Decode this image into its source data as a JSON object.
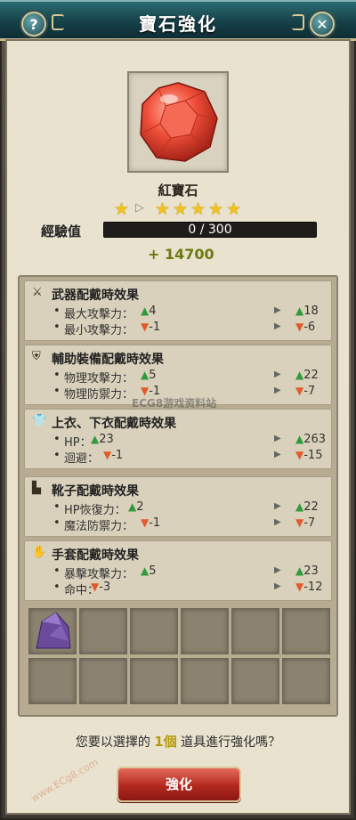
{
  "window": {
    "title": "寶石強化",
    "help_label": "?",
    "close_label": "✕"
  },
  "gem": {
    "name": "紅寶石"
  },
  "stars": {
    "current": 1,
    "next": 5,
    "arrow": "▷"
  },
  "exp": {
    "label": "經驗值",
    "text": "0 / 300",
    "progress": 0,
    "gain": "+ 14700"
  },
  "sections": [
    {
      "icon": "sword-icon",
      "glyph": "⚔",
      "title": "武器配戴時效果",
      "rows": [
        {
          "label": "最大攻擊力：",
          "dir": "up",
          "cur": "4",
          "next_dir": "up",
          "next": "18"
        },
        {
          "label": "最小攻擊力：",
          "dir": "down",
          "cur": "-1",
          "next_dir": "down",
          "next": "-6"
        }
      ]
    },
    {
      "icon": "shield-icon",
      "glyph": "⛨",
      "title": "輔助裝備配戴時效果",
      "rows": [
        {
          "label": "物理攻擊力：",
          "dir": "up",
          "cur": "5",
          "next_dir": "up",
          "next": "22"
        },
        {
          "label": "物理防禦力：",
          "dir": "down",
          "cur": "-1",
          "next_dir": "down",
          "next": "-7"
        }
      ]
    },
    {
      "icon": "shirt-icon",
      "glyph": "👕",
      "title": "上衣、下衣配戴時效果",
      "rows": [
        {
          "label": "HP：",
          "dir": "up",
          "cur": "23",
          "next_dir": "up",
          "next": "263"
        },
        {
          "label": "迴避：",
          "dir": "down",
          "cur": "-1",
          "next_dir": "down",
          "next": "-15"
        }
      ]
    },
    {
      "icon": "boot-icon",
      "glyph": "▙",
      "title": "靴子配戴時效果",
      "rows": [
        {
          "label": "HP恢復力：",
          "dir": "up",
          "cur": "2",
          "next_dir": "up",
          "next": "22"
        },
        {
          "label": "魔法防禦力：",
          "dir": "down",
          "cur": "-1",
          "next_dir": "down",
          "next": "-7"
        }
      ]
    },
    {
      "icon": "glove-icon",
      "glyph": "✋",
      "title": "手套配戴時效果",
      "rows": [
        {
          "label": "暴擊攻擊力：",
          "dir": "up",
          "cur": "5",
          "next_dir": "up",
          "next": "23"
        },
        {
          "label": "命中：",
          "dir": "down",
          "cur": "-3",
          "next_dir": "down",
          "next": "-12"
        }
      ]
    }
  ],
  "slots": {
    "count": 12,
    "filled": [
      0
    ]
  },
  "question": {
    "before": "您要以選擇的 ",
    "count": "1個",
    "after": " 道具進行強化嗎？"
  },
  "enhance_button": "強化",
  "watermark": "ECG8游戏资料站",
  "watermark2": "www.ECg8.com"
}
